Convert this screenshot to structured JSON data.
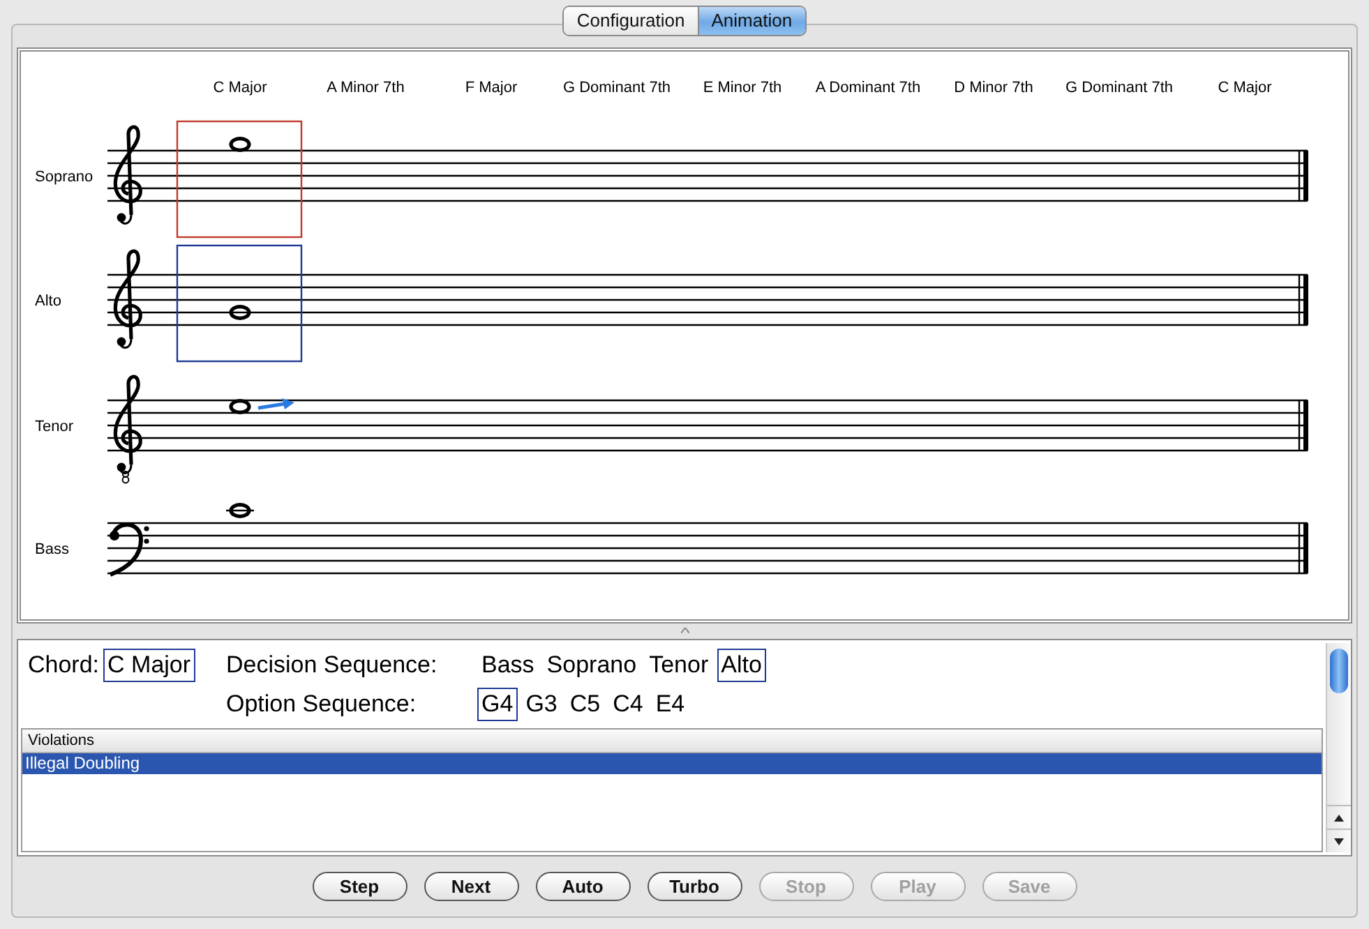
{
  "tabs": [
    {
      "label": "Configuration",
      "selected": false
    },
    {
      "label": "Animation",
      "selected": true
    }
  ],
  "score": {
    "chords": [
      "C Major",
      "A Minor 7th",
      "F Major",
      "G Dominant 7th",
      "E Minor 7th",
      "A Dominant 7th",
      "D Minor 7th",
      "G Dominant 7th",
      "C Major"
    ],
    "staves": [
      {
        "name": "Soprano",
        "kind": "treble",
        "color": "#c0392b",
        "arrow": false
      },
      {
        "name": "Alto",
        "kind": "treble",
        "color": "#1f3a93",
        "arrow": false
      },
      {
        "name": "Tenor",
        "kind": "treble8",
        "arrow": true
      },
      {
        "name": "Bass",
        "kind": "bass",
        "arrow": false
      }
    ]
  },
  "info": {
    "chord_label": "Chord:",
    "chord": "C Major",
    "decision_label": "Decision Sequence:",
    "decision_sequence": [
      {
        "text": "Bass",
        "selected": false
      },
      {
        "text": "Soprano",
        "selected": false
      },
      {
        "text": "Tenor",
        "selected": false
      },
      {
        "text": "Alto",
        "selected": true
      }
    ],
    "option_label": "Option Sequence:",
    "option_sequence": [
      {
        "text": "G4",
        "selected": true
      },
      {
        "text": "G3",
        "selected": false
      },
      {
        "text": "C5",
        "selected": false
      },
      {
        "text": "C4",
        "selected": false
      },
      {
        "text": "E4",
        "selected": false
      }
    ]
  },
  "violations": {
    "header": "Violations",
    "rows": [
      {
        "text": "Illegal Doubling",
        "selected": true
      }
    ]
  },
  "buttons": [
    {
      "label": "Step",
      "disabled": false
    },
    {
      "label": "Next",
      "disabled": false
    },
    {
      "label": "Auto",
      "disabled": false
    },
    {
      "label": "Turbo",
      "disabled": false
    },
    {
      "label": "Stop",
      "disabled": true
    },
    {
      "label": "Play",
      "disabled": true
    },
    {
      "label": "Save",
      "disabled": true
    }
  ]
}
